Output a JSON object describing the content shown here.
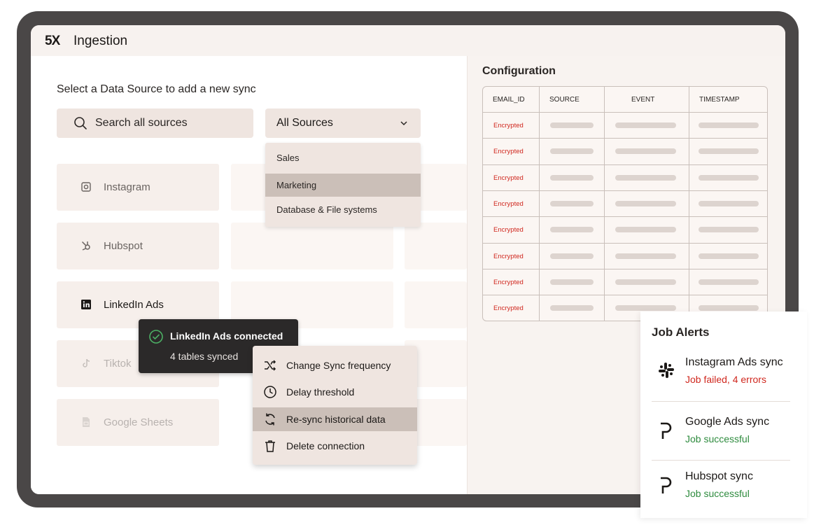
{
  "app": {
    "logo": "5X",
    "title": "Ingestion"
  },
  "main": {
    "prompt": "Select a Data Source to add a new sync",
    "search": {
      "placeholder": "Search all sources"
    },
    "filter": {
      "selected": "All Sources",
      "options": [
        "Sales",
        "Marketing",
        "Database & File systems"
      ],
      "highlighted": "Marketing"
    },
    "sources": [
      {
        "label": "Instagram",
        "icon": "instagram-icon"
      },
      {
        "label": "Hubspot",
        "icon": "hubspot-icon"
      },
      {
        "label": "LinkedIn Ads",
        "icon": "linkedin-icon"
      },
      {
        "label": "Tiktok",
        "icon": "tiktok-icon"
      },
      {
        "label": "Google Sheets",
        "icon": "sheets-icon"
      }
    ]
  },
  "toast": {
    "title": "LinkedIn Ads connected",
    "subtitle": "4 tables synced"
  },
  "context_menu": {
    "items": [
      {
        "label": "Change Sync frequency",
        "icon": "shuffle-icon"
      },
      {
        "label": "Delay threshold",
        "icon": "clock-icon"
      },
      {
        "label": "Re-sync historical data",
        "icon": "refresh-icon"
      },
      {
        "label": "Delete connection",
        "icon": "trash-icon"
      }
    ],
    "highlighted": "Re-sync historical data"
  },
  "configuration": {
    "title": "Configuration",
    "columns": [
      "EMAIL_ID",
      "SOURCE",
      "EVENT",
      "TIMESTAMP"
    ],
    "rows": [
      "Encrypted",
      "Encrypted",
      "Encrypted",
      "Encrypted",
      "Encrypted",
      "Encrypted",
      "Encrypted",
      "Encrypted"
    ]
  },
  "job_alerts": {
    "title": "Job Alerts",
    "items": [
      {
        "name": "Instagram Ads sync",
        "status": "Job failed, 4 errors",
        "state": "error",
        "icon": "slack-icon"
      },
      {
        "name": "Google Ads sync",
        "status": "Job successful",
        "state": "success",
        "icon": "p-logo-icon"
      },
      {
        "name": "Hubspot sync",
        "status": "Job successful",
        "state": "success",
        "icon": "p-logo-icon"
      }
    ]
  },
  "colors": {
    "error": "#d0281f",
    "success": "#2e8b3e",
    "accent": "#cbbfb8",
    "panel": "#efe5e0"
  }
}
